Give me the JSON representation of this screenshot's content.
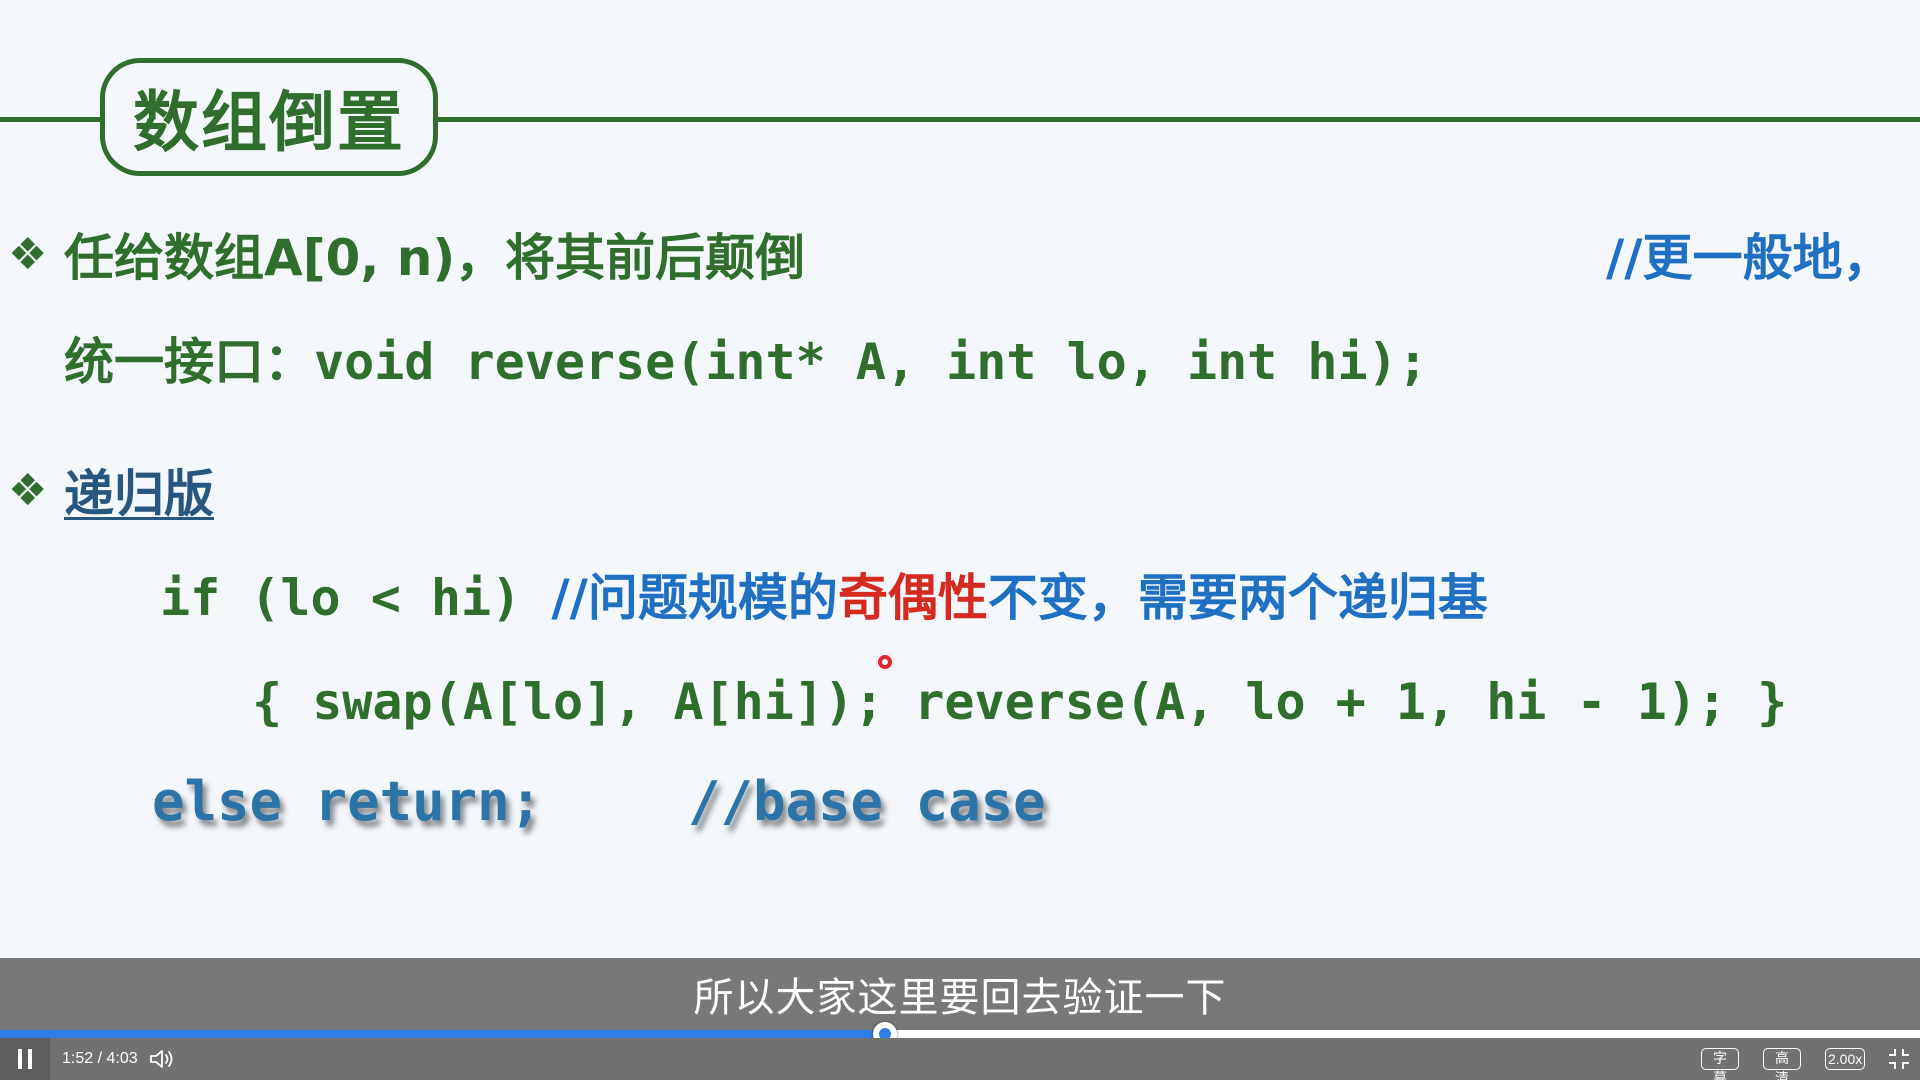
{
  "slide": {
    "title": "数组倒置",
    "line1": {
      "text": "任给数组A[0, n)，将其前后颠倒",
      "comment": "//更一般地，"
    },
    "line2": {
      "label": "统一接口：",
      "code": "void reverse(int* A, int lo, int hi);"
    },
    "line3": {
      "heading": "递归版"
    },
    "line4": {
      "code": "if (lo < hi) ",
      "comment_a": "//问题规模的",
      "comment_red": "奇偶性",
      "comment_b": "不变，需要两个递归基"
    },
    "line5": {
      "code": "{ swap(A[lo], A[hi]); reverse(A, lo + 1, hi - 1); }"
    },
    "line6": {
      "code": "else return;",
      "comment": "//base case"
    }
  },
  "subtitle": "所以大家这里要回去验证一下",
  "player": {
    "time": "1:52 / 4:03",
    "progress": 0.4609,
    "buttons": {
      "subtitles": "字幕",
      "quality": "高清",
      "speed": "2.00x"
    },
    "icons": {
      "pause": "pause-icon",
      "volume": "volume-icon",
      "fullscreen_exit": "exit-fullscreen-icon"
    },
    "accent": "#2f7ee6"
  },
  "colors": {
    "slide_green": "#2f6e2c",
    "comment_blue": "#1f6fc2",
    "highlight_red": "#d42a1f",
    "background": "#f4f8fd"
  }
}
